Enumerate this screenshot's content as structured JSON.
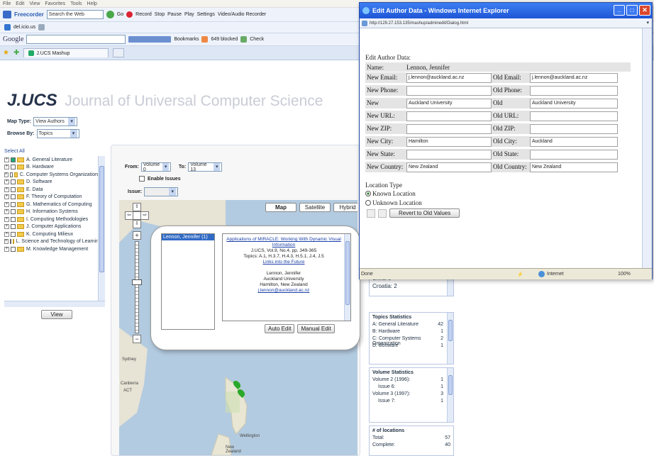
{
  "browser": {
    "menu": [
      "File",
      "Edit",
      "View",
      "Favorites",
      "Tools",
      "Help"
    ],
    "toolbar1": {
      "search_placeholder": "Search the Web",
      "go": "Go",
      "record": "Record",
      "stop": "Stop",
      "pause": "Pause",
      "play": "Play",
      "settings": "Settings",
      "video": "Video/Audio Recorder"
    },
    "toolbar2": {
      "site": "del.icio.us"
    },
    "toolbar3": {
      "google": "Google",
      "bookmarks": "Bookmarks",
      "blocked": "649 blocked",
      "check": "Check"
    },
    "tab_title": "J.UCS Mashup"
  },
  "site": {
    "logo": "J.UCS",
    "tagline": "Journal of Universal Computer Science",
    "map_type_label": "Map Type:",
    "map_type_value": "View Authors",
    "browse_by_label": "Browse By:",
    "browse_by_value": "Topics",
    "select_all": "Select All",
    "topics": [
      "A. General Literature",
      "B. Hardware",
      "C. Computer Systems Organization",
      "D. Software",
      "E. Data",
      "F. Theory of Computation",
      "G. Mathematics of Computing",
      "H. Information Systems",
      "I. Computing Methodologies",
      "J. Computer Applications",
      "K. Computing Milieux",
      "L. Science and Technology of Learning",
      "M. Knowledge Management"
    ],
    "view_button": "View",
    "from_label": "From:",
    "from_value": "Volume 0",
    "to_label": "To:",
    "to_value": "Volume 13",
    "enable_issues": "Enable Issues",
    "issue_label": "Issue:",
    "map_buttons": [
      "Map",
      "Satellite",
      "Hybrid"
    ],
    "map_labels": {
      "sydney": "Sydney",
      "canberra": "Canberra",
      "act": "ACT",
      "wellington": "Wellington",
      "new_zealand": "New Zealand"
    },
    "author_list_item": "Lennon, Jennifer (1)",
    "article": {
      "title": "Applications of MIRACLE: Working With Dynamic Visual Information",
      "citation": "J.UCS, Vol.9, No.4, pp. 349-365",
      "topics": "Topics: A.1, H.3.7, H.4.3, H.5.1, J.4, J.5",
      "link": "Links into the Future",
      "author": "Lennon, Jennifer",
      "institution": "Auckland University",
      "location": "Hamilton, New Zealand",
      "email": "j.lennon@auckland.ac.nz"
    },
    "auto_edit": "Auto Edit",
    "manual_edit": "Manual Edit",
    "countries": [
      "China: 3",
      "Croatia: 2"
    ],
    "topics_stats": {
      "title": "Topics Statistics",
      "rows": [
        [
          "A: General Literature",
          "42"
        ],
        [
          "B: Hardware",
          "1"
        ],
        [
          "C: Computer Systems Organization",
          "2"
        ],
        [
          "D: Software",
          "1"
        ]
      ]
    },
    "volume_stats": {
      "title": "Volume Statistics",
      "rows": [
        [
          "Volume 2 (1996):",
          "1"
        ],
        [
          "Issue 6:",
          "1"
        ],
        [
          "Volume 3 (1997):",
          "3"
        ],
        [
          "Issue 7:",
          "1"
        ]
      ]
    },
    "locations": {
      "title": "# of locations",
      "rows": [
        [
          "Total:",
          "57"
        ],
        [
          "Complete:",
          "40"
        ]
      ]
    }
  },
  "popup": {
    "title": "Edit Author Data - Windows Internet Explorer",
    "url": "http://129.27.153.135/mashup/adminedit/Dialog.html",
    "heading": "Edit Author Data:",
    "name_label": "Name:",
    "name_value": "Lennon, Jennifer",
    "fields": [
      {
        "new_label": "New Email:",
        "new_value": "j.lennon@auckland.ac.nz",
        "old_label": "Old Email:",
        "old_value": "j.lennon@auckland.ac.nz"
      },
      {
        "new_label": "New Phone:",
        "new_value": "",
        "old_label": "Old Phone:",
        "old_value": ""
      },
      {
        "new_label": "New Institution:",
        "new_value": "Auckland University",
        "old_label": "Old Institution:",
        "old_value": "Auckland University"
      },
      {
        "new_label": "New URL:",
        "new_value": "",
        "old_label": "Old URL:",
        "old_value": ""
      },
      {
        "new_label": "New ZIP:",
        "new_value": "",
        "old_label": "Old ZIP:",
        "old_value": ""
      },
      {
        "new_label": "New City:",
        "new_value": "Hamilton",
        "old_label": "Old City:",
        "old_value": "Auckland"
      },
      {
        "new_label": "New State:",
        "new_value": "",
        "old_label": "Old State:",
        "old_value": ""
      },
      {
        "new_label": "New Country:",
        "new_value": "New Zealand",
        "old_label": "Old Country:",
        "old_value": "New Zealand"
      }
    ],
    "location_type": "Location Type",
    "known": "Known Location",
    "unknown": "Unknown Location",
    "revert": "Revert to Old Values",
    "status_done": "Done",
    "status_zone": "Internet",
    "status_zoom": "100%"
  }
}
